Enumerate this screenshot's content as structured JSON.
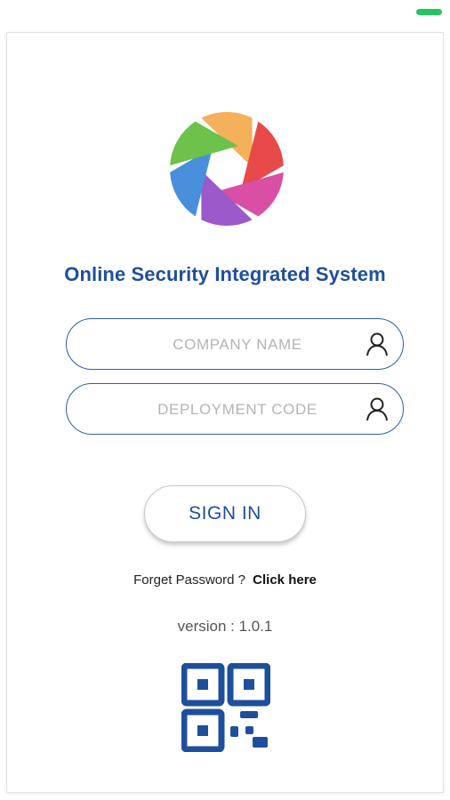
{
  "app": {
    "title": "Online Security Integrated System",
    "logo_icon": "aperture-logo-icon"
  },
  "form": {
    "company_name_placeholder": "COMPANY NAME",
    "company_name_value": "",
    "company_name_icon": "user-icon",
    "deployment_code_placeholder": "DEPLOYMENT CODE",
    "deployment_code_value": "",
    "deployment_code_icon": "user-icon",
    "sign_in_label": "SIGN IN"
  },
  "forgot": {
    "prompt": "Forget Password ?",
    "link_text": "Click here"
  },
  "version": {
    "label": "version : 1.0.1"
  },
  "qr": {
    "icon": "qr-code-icon"
  },
  "colors": {
    "primary": "#1e4f9c",
    "field_border": "#2f5ea8",
    "status_indicator": "#22c55e",
    "logo_green": "#6cc24a",
    "logo_orange": "#f4b05a",
    "logo_red": "#e84a4a",
    "logo_pink": "#d94fa5",
    "logo_purple": "#9b59c9",
    "logo_blue": "#4a8fdb"
  }
}
